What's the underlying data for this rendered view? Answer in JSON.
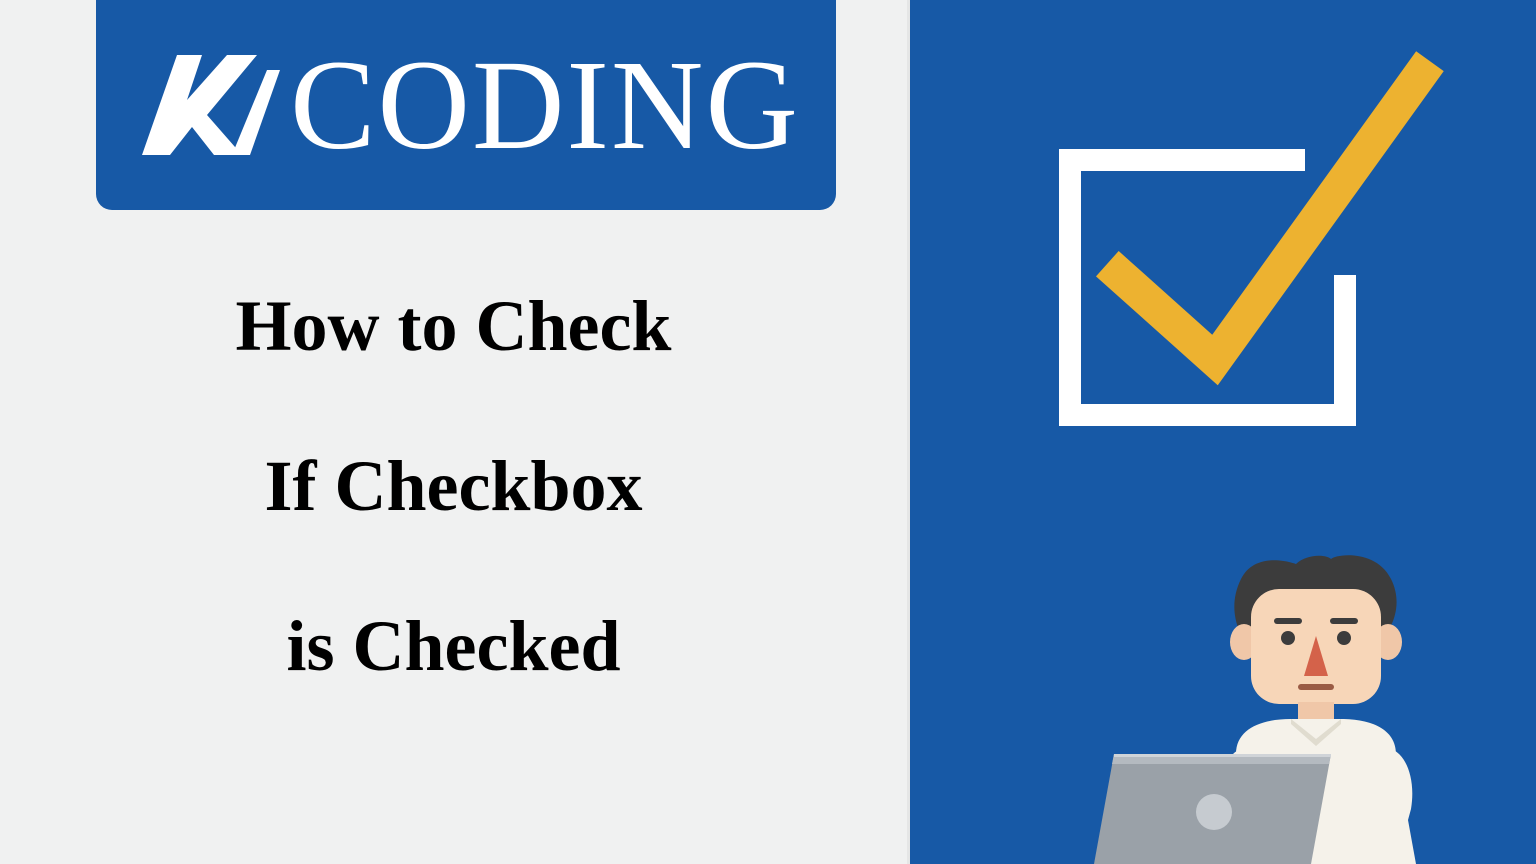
{
  "logo": {
    "text": "CODING"
  },
  "title": {
    "line1": "How to Check",
    "line2": "If Checkbox",
    "line3": "is Checked"
  },
  "colors": {
    "brand_blue": "#1759a6",
    "accent_yellow": "#edb230",
    "bg_light": "#f0f1f1"
  }
}
